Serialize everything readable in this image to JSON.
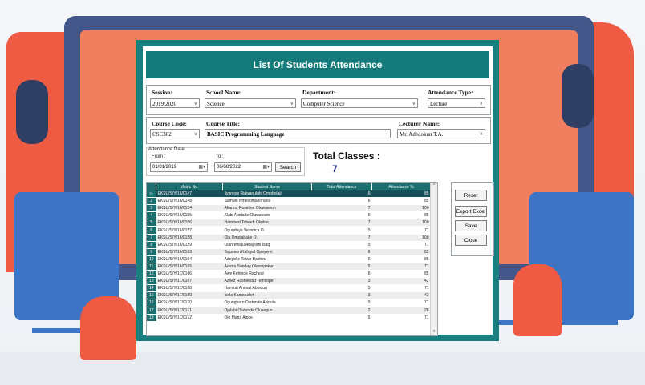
{
  "window": {
    "title": "List Of Students Attendance"
  },
  "session": {
    "label": "Session:",
    "value": "2019/2020"
  },
  "school": {
    "label": "School Name:",
    "value": "Science"
  },
  "department": {
    "label": "Department:",
    "value": "Computer Science"
  },
  "attendance_type": {
    "label": "Attendance Type:",
    "value": "Lecture"
  },
  "course_code": {
    "label": "Course Code:",
    "value": "CSC302"
  },
  "course_title": {
    "label": "Course Title:",
    "value": "BASIC Programming Language"
  },
  "lecturer": {
    "label": "Lecturer Name:",
    "value": "Mr. Adedokun T.A."
  },
  "attendance_date": {
    "group_label": "Attendance Date",
    "from_label": "From :",
    "from_value": "01/01/2019",
    "to_label": "To :",
    "to_value": "06/08/2022",
    "search_label": "Search"
  },
  "totals": {
    "label": "Total Classes :",
    "value": "7"
  },
  "grid": {
    "columns": [
      "Matric No.",
      "Student Name",
      "Total Attendance",
      "Attendance %"
    ],
    "row_headers": [
      "▷",
      "2",
      "3",
      "4",
      "5",
      "6",
      "7",
      "8",
      "9",
      "10",
      "11",
      "12",
      "13",
      "14",
      "15",
      "16",
      "17",
      "18"
    ],
    "rows": [
      [
        "EKSU/S/Y/16/0147",
        "Ilyanoye Ridwanulahi Omobolaji",
        "6",
        "85"
      ],
      [
        "EKSU/S/Y/16/0148",
        "Samuel Nmesoma Innana",
        "6",
        "85"
      ],
      [
        "EKSU/S/Y/16/0154",
        "Akannu Roseline Oluwaseun",
        "7",
        "100"
      ],
      [
        "EKSU/S/Y/16/0155",
        "Alabi Abidade Oluwatosin",
        "6",
        "85"
      ],
      [
        "EKSU/S/Y/16/0156",
        "Hammed Toheeb Olaitan",
        "7",
        "100"
      ],
      [
        "EKSU/S/Y/16/0157",
        "Ogundoye Veronica O.",
        "5",
        "71"
      ],
      [
        "EKSU/S/Y/16/0158",
        "Ola Omolabake O.",
        "7",
        "100"
      ],
      [
        "EKSU/S/Y/16/0159",
        "Olanrewaju Abayomi Isaq",
        "5",
        "71"
      ],
      [
        "EKSU/S/Y/16/0163",
        "Tajudeen Kafayat Opeyemi",
        "6",
        "85"
      ],
      [
        "EKSU/S/Y/16/0164",
        "Adegoke Taiwo Bashiru",
        "6",
        "85"
      ],
      [
        "EKSU/S/Y/16/0165",
        "Aremu Sunday Olaonipekun",
        "5",
        "71"
      ],
      [
        "EKSU/S/Y/17/0166",
        "Awe Kehinde Racheal",
        "6",
        "85"
      ],
      [
        "EKSU/S/Y/17/0167",
        "Azeez Rasheedat Temitope",
        "3",
        "42"
      ],
      [
        "EKSU/S/Y/17/0168",
        "Hamzat Aminat Abiodun",
        "5",
        "71"
      ],
      [
        "EKSU/S/Y/17/0169",
        "Isola Kamorudeh",
        "3",
        "42"
      ],
      [
        "EKSU/S/Y/17/0170",
        "Ogungbaro Olatunde Akinola",
        "5",
        "71"
      ],
      [
        "EKSU/S/Y/17/0171",
        "Ojelabi Olutunde Olusegun",
        "2",
        "28"
      ],
      [
        "EKSU/S/Y/17/0172",
        "Ojo Maria Ajoke",
        "5",
        "71"
      ]
    ]
  },
  "actions": {
    "reset": "Reset",
    "export": "Export Excel",
    "save": "Save",
    "close": "Close"
  },
  "icons": {
    "scroll_up": "chevron-up-icon",
    "scroll_down": "chevron-down-icon",
    "calendar": "calendar-icon",
    "row_pointer": "row-pointer-icon"
  },
  "colors": {
    "accent": "#157a7a",
    "frame": "#1a7f7f",
    "selected_row": "#174f5a",
    "total_value": "#1b2f7a"
  }
}
